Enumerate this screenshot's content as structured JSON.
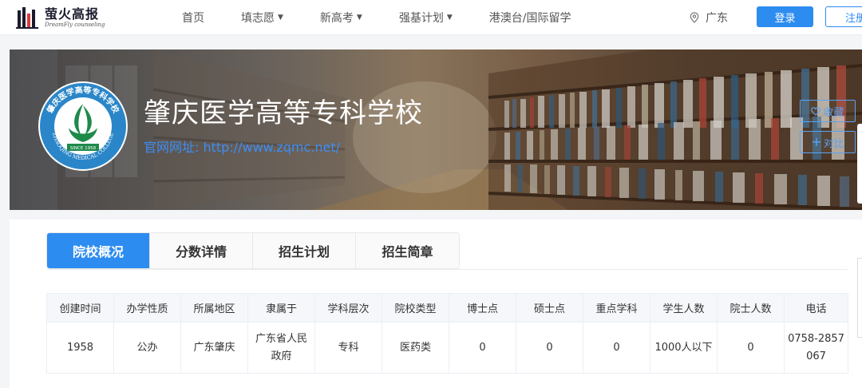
{
  "header": {
    "logo_cn": "萤火高报",
    "logo_en": "DreamFly counseling",
    "nav": [
      {
        "label": "首页",
        "dropdown": false
      },
      {
        "label": "填志愿",
        "dropdown": true
      },
      {
        "label": "新高考",
        "dropdown": true
      },
      {
        "label": "强基计划",
        "dropdown": true
      },
      {
        "label": "港澳台/国际留学",
        "dropdown": false
      }
    ],
    "location": "广东",
    "login_label": "登录",
    "register_label": "注册"
  },
  "banner": {
    "school_name": "肇庆医学高等专科学校",
    "website_label": "官网网址: ",
    "website_url": "http://www.zqmc.net/",
    "logo_text_top": "肇庆医学高等专科学校",
    "logo_text_bottom": "ZHAOQING MEDICAL COLLEGE",
    "logo_since": "SINCE 1958",
    "favorite_label": "收藏",
    "compare_label": "对比"
  },
  "tabs": [
    {
      "label": "院校概况",
      "active": true
    },
    {
      "label": "分数详情",
      "active": false
    },
    {
      "label": "招生计划",
      "active": false
    },
    {
      "label": "招生简章",
      "active": false
    }
  ],
  "info_table": {
    "headers": [
      "创建时间",
      "办学性质",
      "所属地区",
      "隶属于",
      "学科层次",
      "院校类型",
      "博士点",
      "硕士点",
      "重点学科",
      "学生人数",
      "院士人数",
      "电话"
    ],
    "values": [
      "1958",
      "公办",
      "广东肇庆",
      "广东省人民政府",
      "专科",
      "医药类",
      "0",
      "0",
      "0",
      "1000人以下",
      "0",
      "0758-2857067"
    ]
  },
  "colors": {
    "primary": "#2d8cf0",
    "logo_green": "#1e8a4a",
    "logo_blue": "#2a86c8"
  }
}
